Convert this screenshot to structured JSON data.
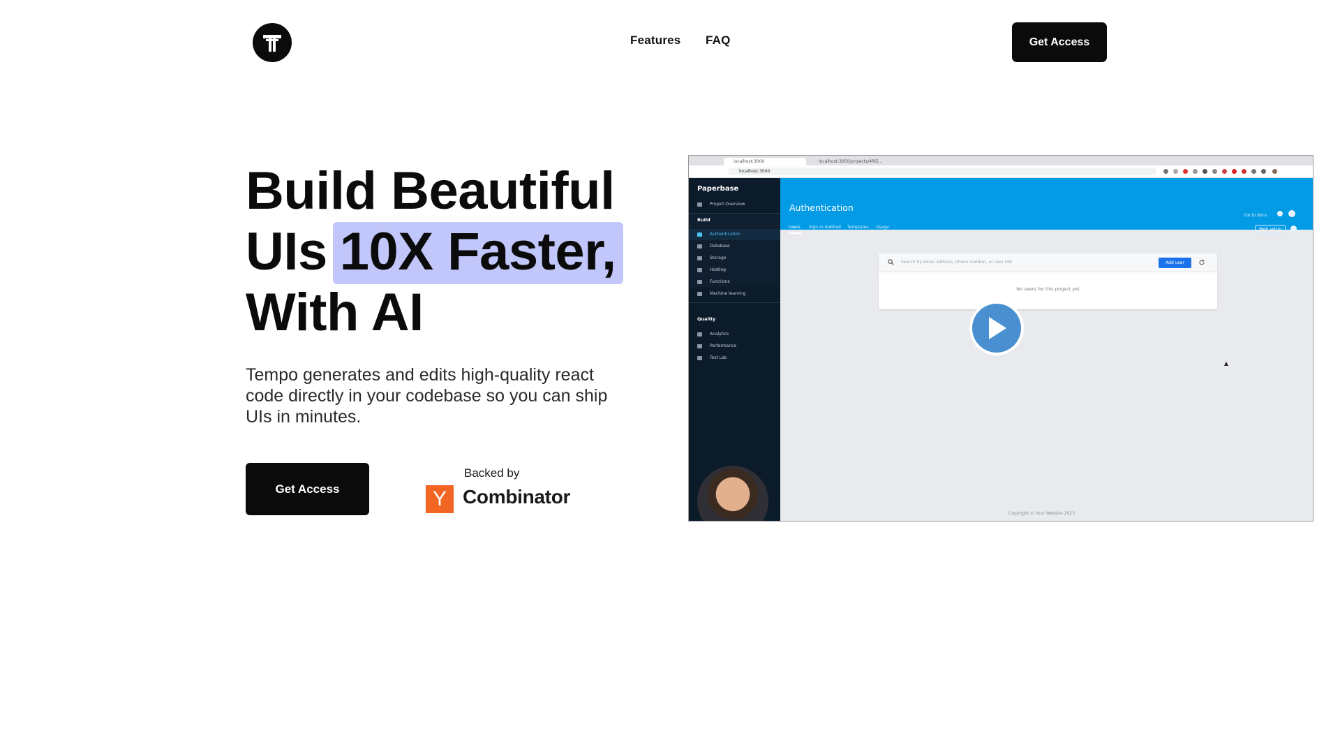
{
  "nav": {
    "links": [
      "Features",
      "FAQ"
    ],
    "cta": "Get Access"
  },
  "hero": {
    "headline_line1": "Build Beautiful",
    "headline_line2_plain": "UIs",
    "headline_line2_highlight": "10X Faster,",
    "headline_line3": "With AI",
    "subtext": "Tempo generates and edits high-quality react code directly in your codebase so you can ship UIs in minutes.",
    "cta": "Get Access",
    "backed_by": "Backed by",
    "yc_letter": "Y",
    "yc_name": "Combinator",
    "highlight_color": "#c2c7fb",
    "yc_color": "#f26522"
  },
  "video": {
    "browser": {
      "tab1": "localhost:3000",
      "tab2": "localhost:3050/projects/4f65...",
      "url": "localhost:3000"
    },
    "app": {
      "brand": "Paperbase",
      "project_overview": "Project Overview",
      "build_heading": "Build",
      "build_items": [
        "Authentication",
        "Database",
        "Storage",
        "Hosting",
        "Functions",
        "Machine learning"
      ],
      "quality_heading": "Quality",
      "quality_items": [
        "Analytics",
        "Performance",
        "Test Lab"
      ],
      "page_title": "Authentication",
      "tabs": [
        "Users",
        "Sign-in method",
        "Templates",
        "Usage"
      ],
      "go_to_docs": "Go to docs",
      "web_setup": "Web setup",
      "search_placeholder": "Search by email address, phone number, or user UID",
      "add_user": "Add user",
      "empty_message": "No users for this project yet",
      "copyright": "Copyright © Your Website 2023.",
      "header_color": "#039be5",
      "sidebar_color": "#0c1b2a"
    },
    "play_color": "#4a90d0"
  }
}
